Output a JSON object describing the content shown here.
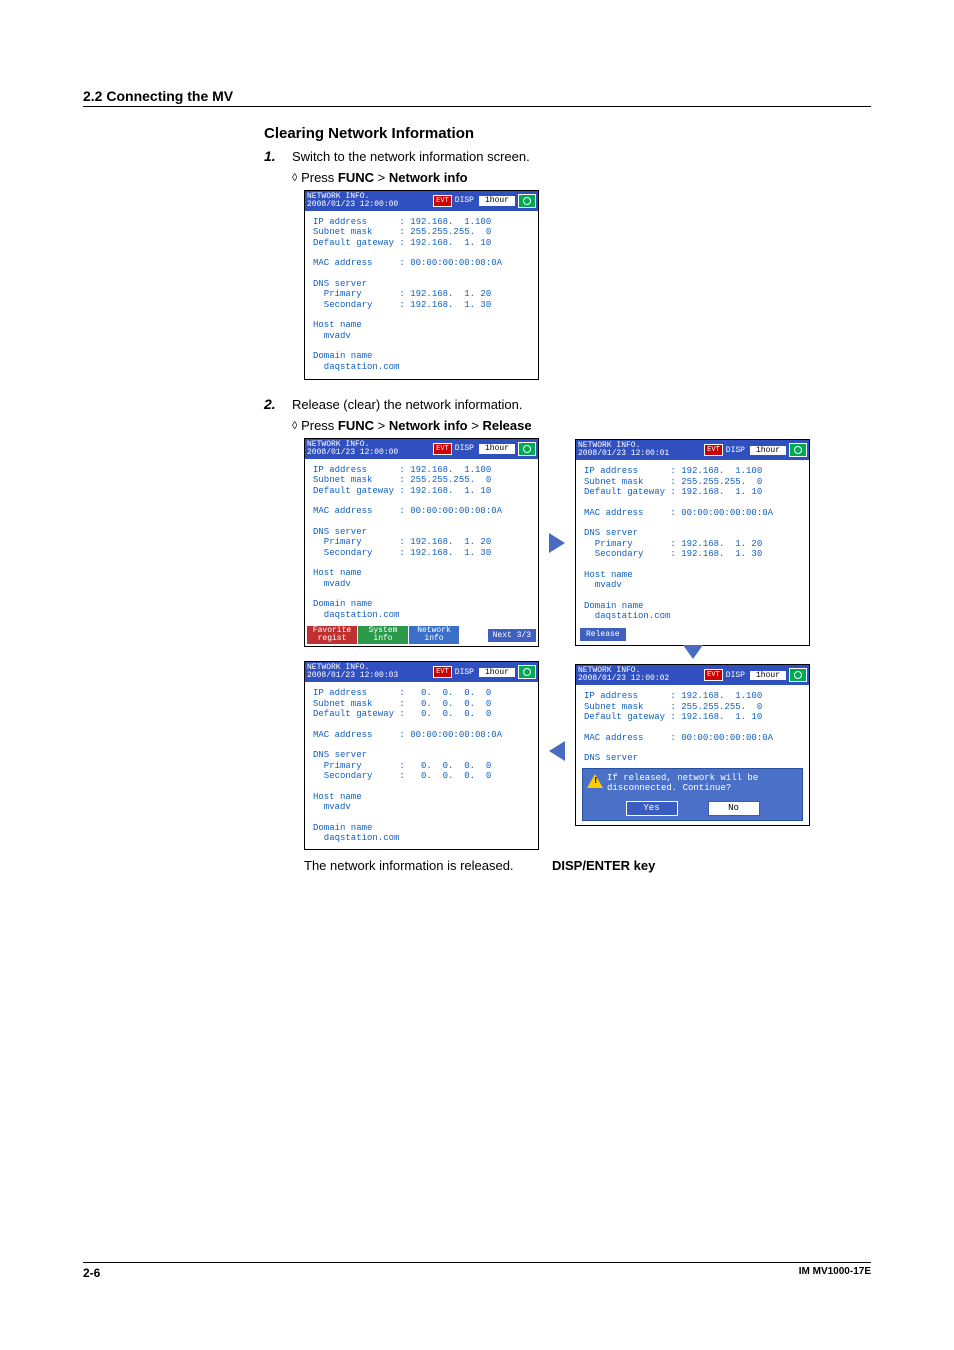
{
  "header": {
    "section": "2.2  Connecting the MV"
  },
  "h3": "Clearing Network Information",
  "steps": {
    "s1": {
      "num": "1.",
      "text": "Switch to the network information screen."
    },
    "s2": {
      "num": "2.",
      "text": "Release (clear) the network information."
    }
  },
  "press": {
    "diamond": "◊",
    "press": "Press",
    "func": "FUNC",
    "gt": ">",
    "ni": "Network info",
    "rel": "Release"
  },
  "titlebar": {
    "title1": "NETWORK INFO.",
    "ts00": "2008/01/23 12:00:00",
    "ts01": "2008/01/23 12:00:01",
    "ts02": "2008/01/23 12:00:02",
    "ts03": "2008/01/23 12:00:03",
    "disp": "DISP",
    "evt": "EVT",
    "hour": "1hour"
  },
  "net": {
    "full": "IP address      : 192.168.  1.100\nSubnet mask     : 255.255.255.  0\nDefault gateway : 192.168.  1. 10\n\nMAC address     : 00:00:00:00:00:0A\n\nDNS server\n  Primary       : 192.168.  1. 20\n  Secondary     : 192.168.  1. 30\n\nHost name\n  mvadv\n\nDomain name\n  daqstation.com",
    "topOnly": "IP address      : 192.168.  1.100\nSubnet mask     : 255.255.255.  0\nDefault gateway : 192.168.  1. 10\n\nMAC address     : 00:00:00:00:00:0A\n\nDNS server",
    "zero": "IP address      :   0.  0.  0.  0\nSubnet mask     :   0.  0.  0.  0\nDefault gateway :   0.  0.  0.  0\n\nMAC address     : 00:00:00:00:00:0A\n\nDNS server\n  Primary       :   0.  0.  0.  0\n  Secondary     :   0.  0.  0.  0\n\nHost name\n  mvadv\n\nDomain name\n  daqstation.com"
  },
  "tabs": {
    "fav1": "Favorite",
    "fav2": "regist",
    "sys1": "System",
    "sys2": "info",
    "net1": "Network",
    "net2": "info",
    "next": "Next 3/3"
  },
  "release_btn": "Release",
  "dialog": {
    "msg": "If released, network will be\ndisconnected. Continue?",
    "yes": "Yes",
    "no": "No"
  },
  "captions": {
    "released": "The network information is released.",
    "dispenter": "DISP/ENTER key"
  },
  "footer": {
    "page": "2-6",
    "doc": "IM MV1000-17E"
  }
}
